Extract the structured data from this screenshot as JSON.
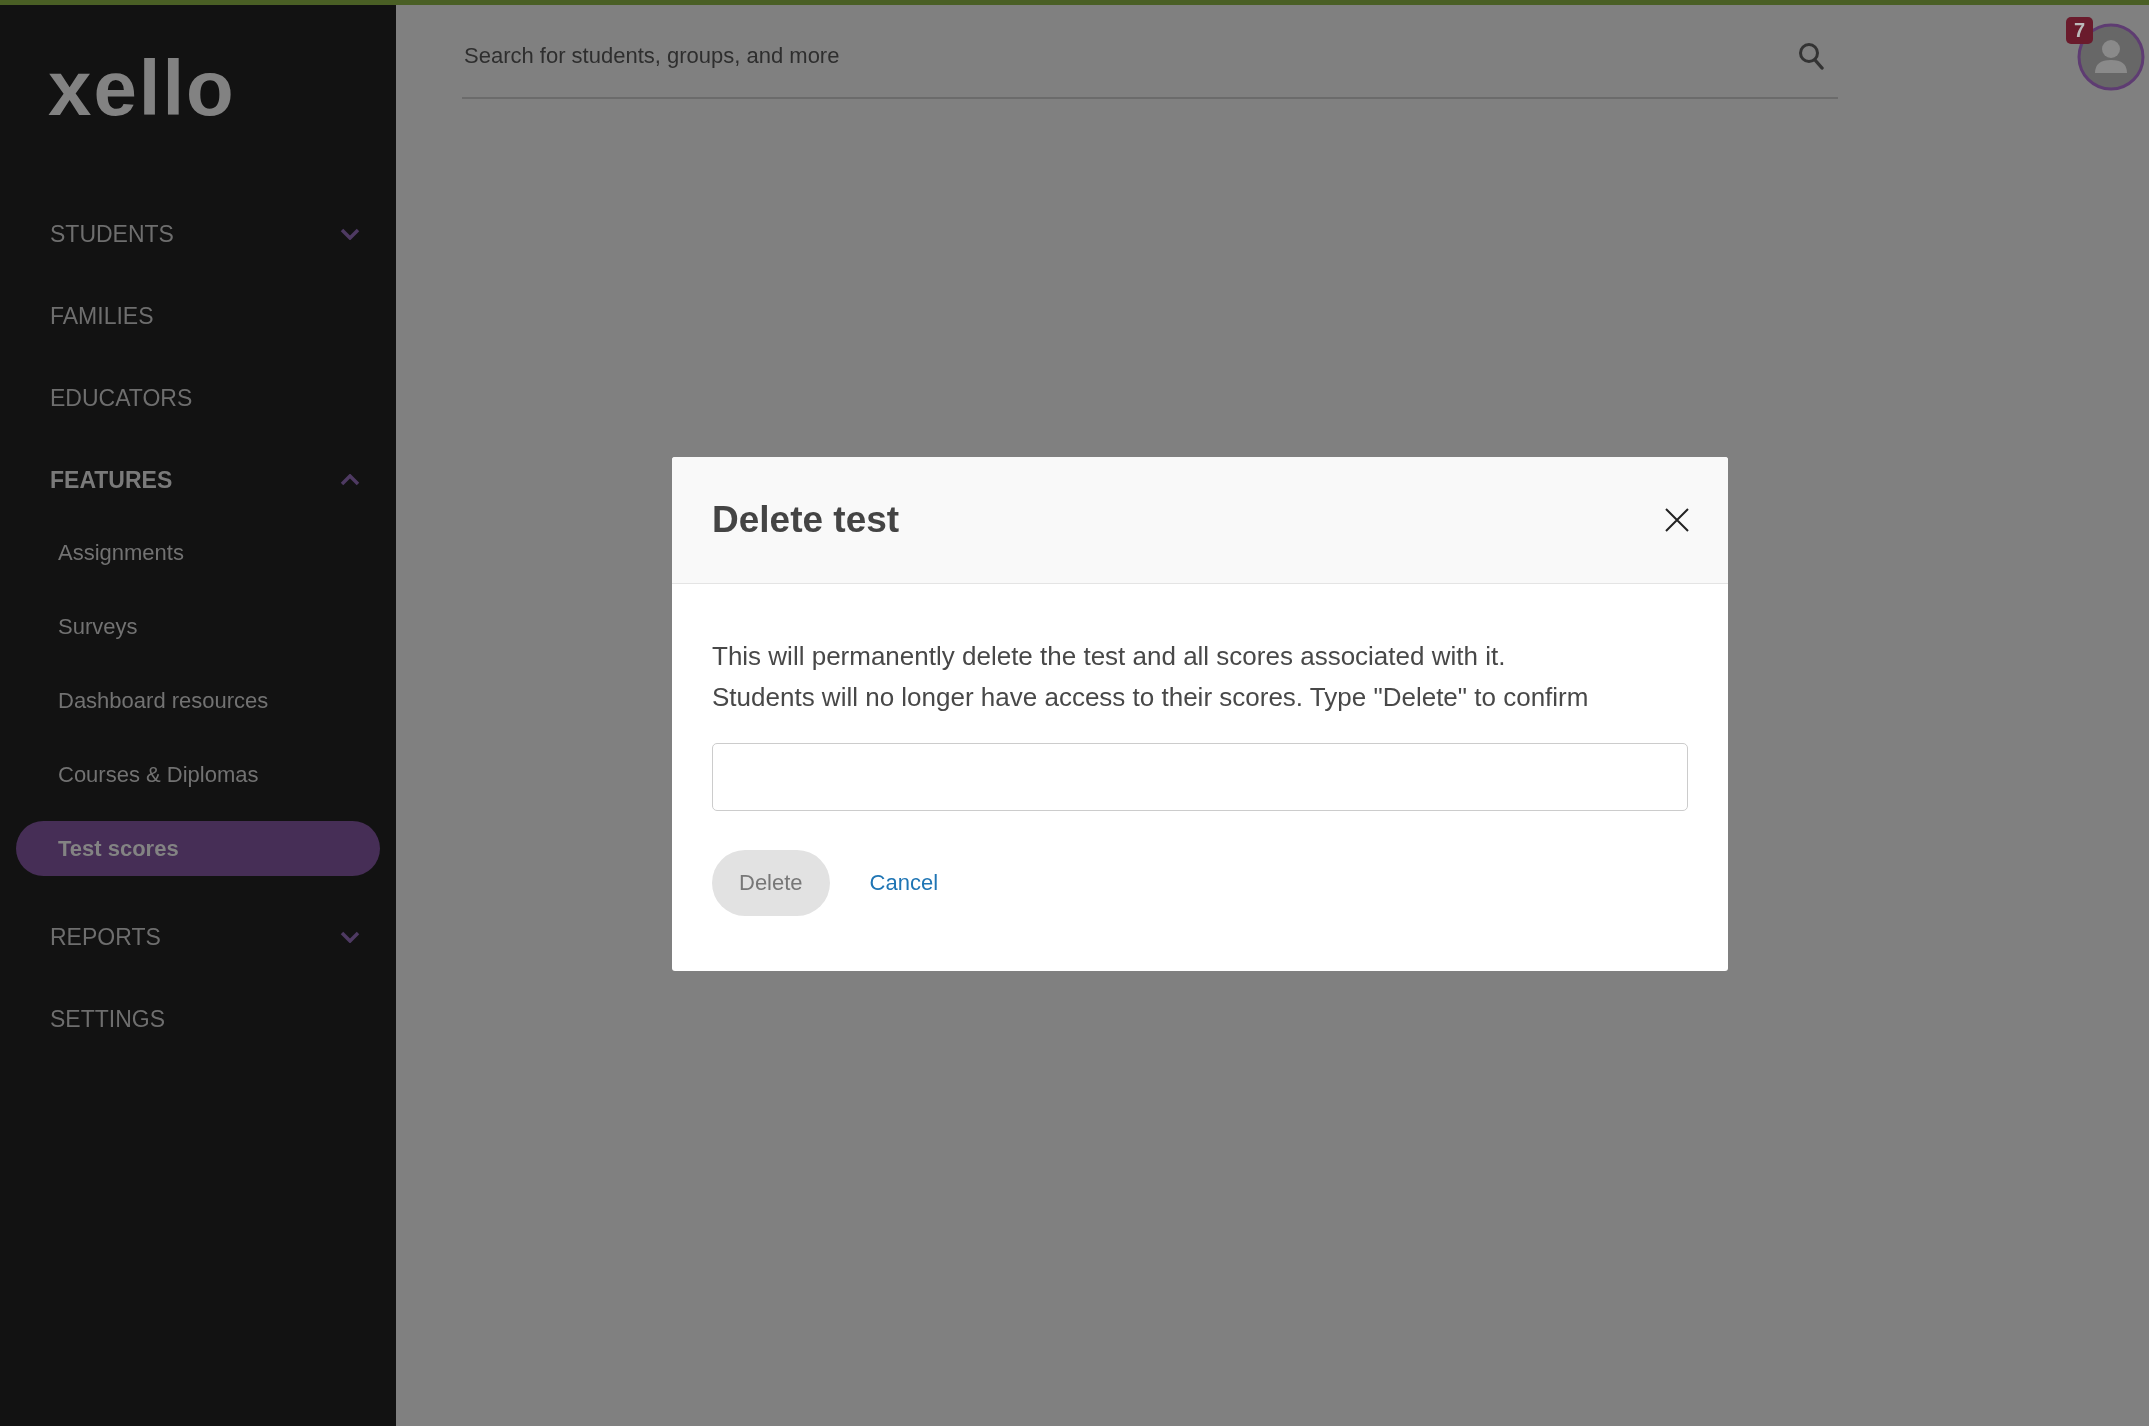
{
  "logo": "xello",
  "nav": [
    {
      "label": "STUDENTS",
      "expanded": false
    },
    {
      "label": "FAMILIES"
    },
    {
      "label": "EDUCATORS"
    },
    {
      "label": "FEATURES",
      "expanded": true,
      "children": [
        {
          "label": "Assignments",
          "selected": false
        },
        {
          "label": "Surveys",
          "selected": false
        },
        {
          "label": "Dashboard resources",
          "selected": false
        },
        {
          "label": "Courses & Diplomas",
          "selected": false
        },
        {
          "label": "Test scores",
          "selected": true
        }
      ]
    },
    {
      "label": "REPORTS",
      "expanded": false
    },
    {
      "label": "SETTINGS"
    }
  ],
  "search": {
    "placeholder": "Search for students, groups, and more"
  },
  "notifications": {
    "count": "7"
  },
  "dialog": {
    "title": "Delete test",
    "message": "This will permanently delete the test and all scores associated with it. Students will no longer have access to their scores. Type \"Delete\" to confirm",
    "confirm": {
      "label": "Delete",
      "disabled": true
    },
    "cancel": "Cancel"
  }
}
